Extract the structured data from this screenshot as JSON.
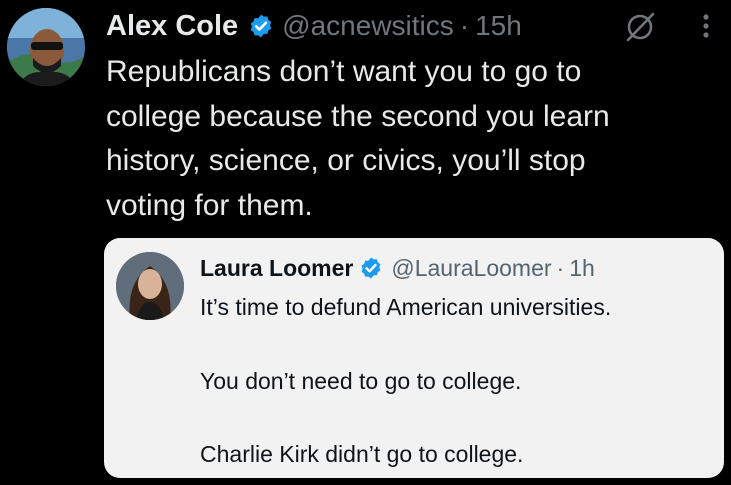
{
  "post": {
    "author_name": "Alex Cole",
    "handle": "@acnewsitics",
    "separator": "·",
    "time": "15h",
    "text_lines": [
      "Republicans don’t want you to go to",
      "college because the second you learn",
      "history, science, or civics, you’ll stop",
      "voting for them."
    ]
  },
  "quoted_post": {
    "author_name": "Laura Loomer",
    "handle": "@LauraLoomer",
    "separator": "·",
    "time": "1h",
    "text_lines": [
      "It’s time to defund American universities.",
      "You don’t need to go to college.",
      "Charlie Kirk didn’t go to college."
    ]
  },
  "icons": [
    "verified-badge-icon",
    "grok-icon",
    "more-options-icon"
  ],
  "colors": {
    "background": "#000000",
    "text": "#e7e9ea",
    "muted": "#71767b",
    "verified": "#1d9bf0",
    "quote_background": "#f2f2f2"
  }
}
